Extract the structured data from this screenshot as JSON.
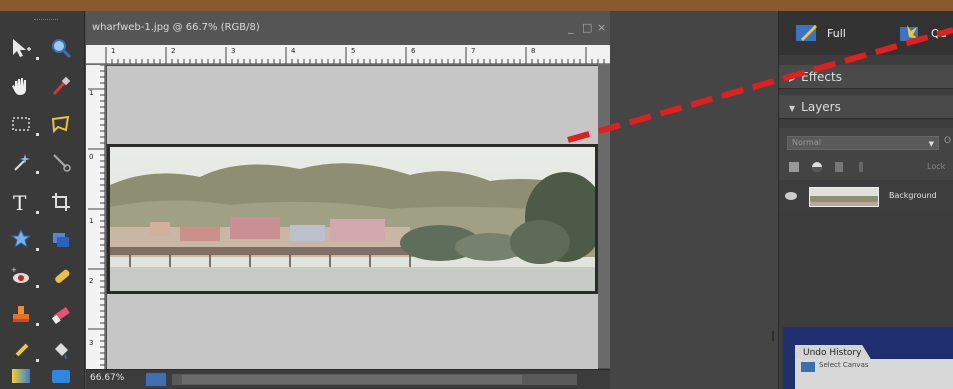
{
  "document": {
    "title": "wharfweb-1.jpg @ 66.7% (RGB/8)",
    "window_controls": [
      "_",
      "□",
      "×"
    ],
    "zoom_readout": "66.67%",
    "ruler_h_ticks": [
      "1",
      "2",
      "3",
      "4",
      "5",
      "6",
      "7",
      "8"
    ],
    "ruler_v_ticks": [
      "1",
      "0",
      "1",
      "2",
      "3"
    ]
  },
  "toolbox": {
    "tools": [
      "move-tool",
      "zoom-tool",
      "hand-tool",
      "eyedropper-tool",
      "marquee-tool",
      "lasso-tool",
      "magic-wand-tool",
      "selection-brush-tool",
      "type-tool",
      "crop-tool",
      "cookie-cutter-tool",
      "straighten-tool",
      "red-eye-tool",
      "healing-brush-tool",
      "clone-stamp-tool",
      "eraser-tool",
      "pencil-tool",
      "paint-bucket-tool",
      "gradient-tool",
      "shape-tool"
    ]
  },
  "palette": {
    "modes": [
      {
        "label": "Full"
      },
      {
        "label": "Qu"
      }
    ],
    "panels": {
      "effects_label": "Effects",
      "layers_label": "Layers"
    },
    "blend_mode": "Normal",
    "opacity_hint": "O",
    "lock_label": "Lock",
    "layer_name": "Background",
    "undo_tab_label": "Undo History",
    "undo_item": "Select Canvas"
  },
  "colors": {
    "accent_orange": "#8a5a2e",
    "dashed_line": "#e02020",
    "undo_panel_blue": "#1e2e6e"
  }
}
